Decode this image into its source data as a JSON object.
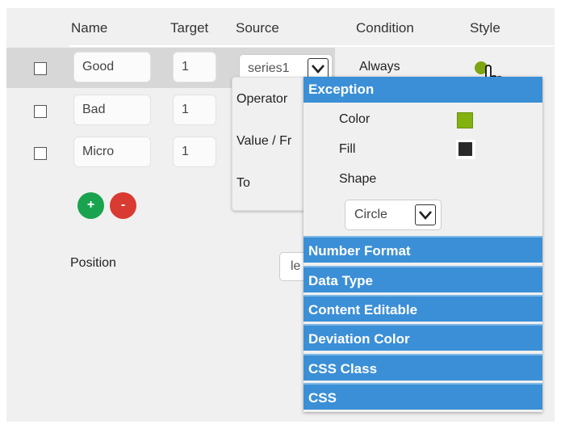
{
  "colors": {
    "accent": "#3b8fd6",
    "add_button": "#1aa34f",
    "remove_button": "#d93a31",
    "style_dot": "#7ea512",
    "exception_color_swatch": "#82b20f",
    "exception_fill_swatch": "#2b2b2b"
  },
  "table": {
    "headers": {
      "name": "Name",
      "target": "Target",
      "source": "Source",
      "condition": "Condition",
      "style": "Style"
    },
    "rows": [
      {
        "name": "Good",
        "target": "1",
        "source": "series1",
        "condition": "Always",
        "selected": true
      },
      {
        "name": "Bad",
        "target": "1"
      },
      {
        "name": "Micro",
        "target": "1"
      }
    ]
  },
  "buttons": {
    "add": "+",
    "remove": "-"
  },
  "position_label": "Position",
  "position_value_partial": "le",
  "condition_panel": {
    "operator_label": "Operator",
    "value_from_label": "Value / Fr",
    "to_label": "To"
  },
  "menu": {
    "exception": {
      "title": "Exception",
      "color_label": "Color",
      "fill_label": "Fill",
      "shape_label": "Shape",
      "shape_value": "Circle"
    },
    "sections": [
      "Number Format",
      "Data Type",
      "Content Editable",
      "Deviation Color",
      "CSS Class",
      "CSS"
    ]
  },
  "icons": {
    "cursor": "hand-pointer-icon",
    "dropdown": "chevron-down-icon"
  }
}
